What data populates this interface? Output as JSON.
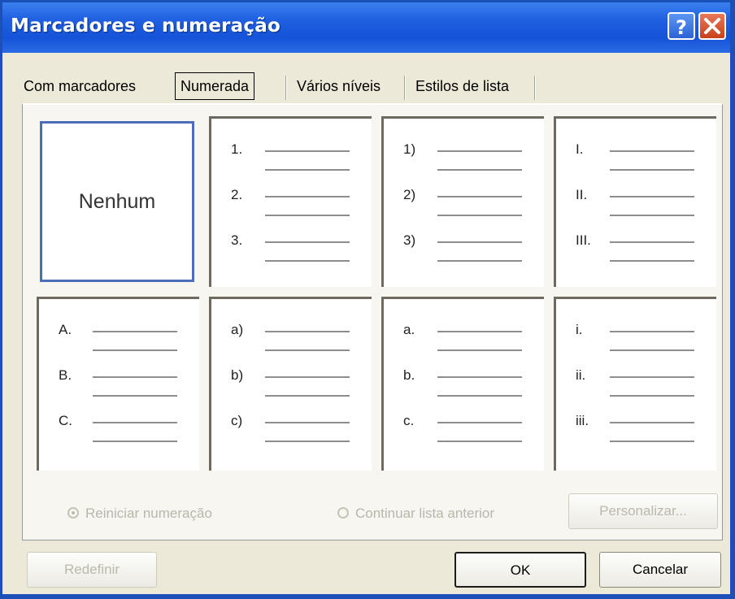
{
  "window": {
    "title": "Marcadores e numeração",
    "help_icon": "help-icon",
    "close_icon": "close-icon"
  },
  "tabs": [
    {
      "label": "Com marcadores",
      "active": false
    },
    {
      "label": "Numerada",
      "active": true
    },
    {
      "label": "Vários níveis",
      "active": false
    },
    {
      "label": "Estilos de lista",
      "active": false
    }
  ],
  "gallery": {
    "none_label": "Nenhum",
    "cells": [
      {
        "markers": [
          "1.",
          "2.",
          "3."
        ]
      },
      {
        "markers": [
          "1)",
          "2)",
          "3)"
        ]
      },
      {
        "markers": [
          "I.",
          "II.",
          "III."
        ]
      },
      {
        "markers": [
          "A.",
          "B.",
          "C."
        ]
      },
      {
        "markers": [
          "a)",
          "b)",
          "c)"
        ]
      },
      {
        "markers": [
          "a.",
          "b.",
          "c."
        ]
      },
      {
        "markers": [
          "i.",
          "ii.",
          "iii."
        ]
      }
    ]
  },
  "options": {
    "restart_label": "Reiniciar numeração",
    "continue_label": "Continuar lista anterior",
    "customize_label": "Personalizar..."
  },
  "buttons": {
    "reset_label": "Redefinir",
    "ok_label": "OK",
    "cancel_label": "Cancelar"
  },
  "colors": {
    "titlebar": "#1f5fe0",
    "selection": "#4a6fb8",
    "disabled_text": "#b9b6aa"
  }
}
